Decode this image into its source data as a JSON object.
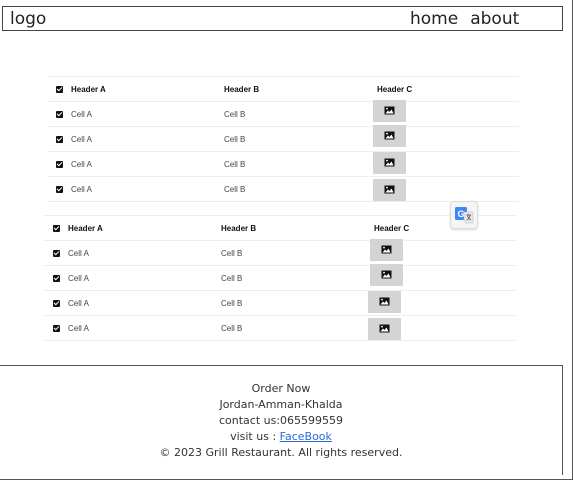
{
  "nav": {
    "logo": "logo",
    "links": [
      "home",
      "about"
    ]
  },
  "tables": [
    {
      "headers": [
        "Header A",
        "Header B",
        "Header C"
      ],
      "rows": [
        [
          "Cell A",
          "Cell B"
        ],
        [
          "Cell A",
          "Cell B"
        ],
        [
          "Cell A",
          "Cell B"
        ],
        [
          "Cell A",
          "Cell B"
        ]
      ]
    },
    {
      "headers": [
        "Header A",
        "Header B",
        "Header C"
      ],
      "rows": [
        [
          "Cell A",
          "Cell B"
        ],
        [
          "Cell A",
          "Cell B"
        ],
        [
          "Cell A",
          "Cell B"
        ],
        [
          "Cell A",
          "Cell B"
        ]
      ]
    }
  ],
  "footer": {
    "order": "Order Now",
    "address": "Jordan-Amman-Khalda",
    "contact": "contact us:065599559",
    "visit_prefix": "visit us :",
    "visit_link": "FaceBook",
    "copyright": "© 2023 Grill Restaurant. All rights reserved."
  },
  "colors": {
    "image_placeholder": "#d4d4d4",
    "link": "#2a6ad8",
    "translate_blue": "#4285f4"
  },
  "icons": {
    "row_image": "image-icon",
    "checkbox": "checkbox-checked-icon",
    "translate": "google-translate-icon"
  }
}
